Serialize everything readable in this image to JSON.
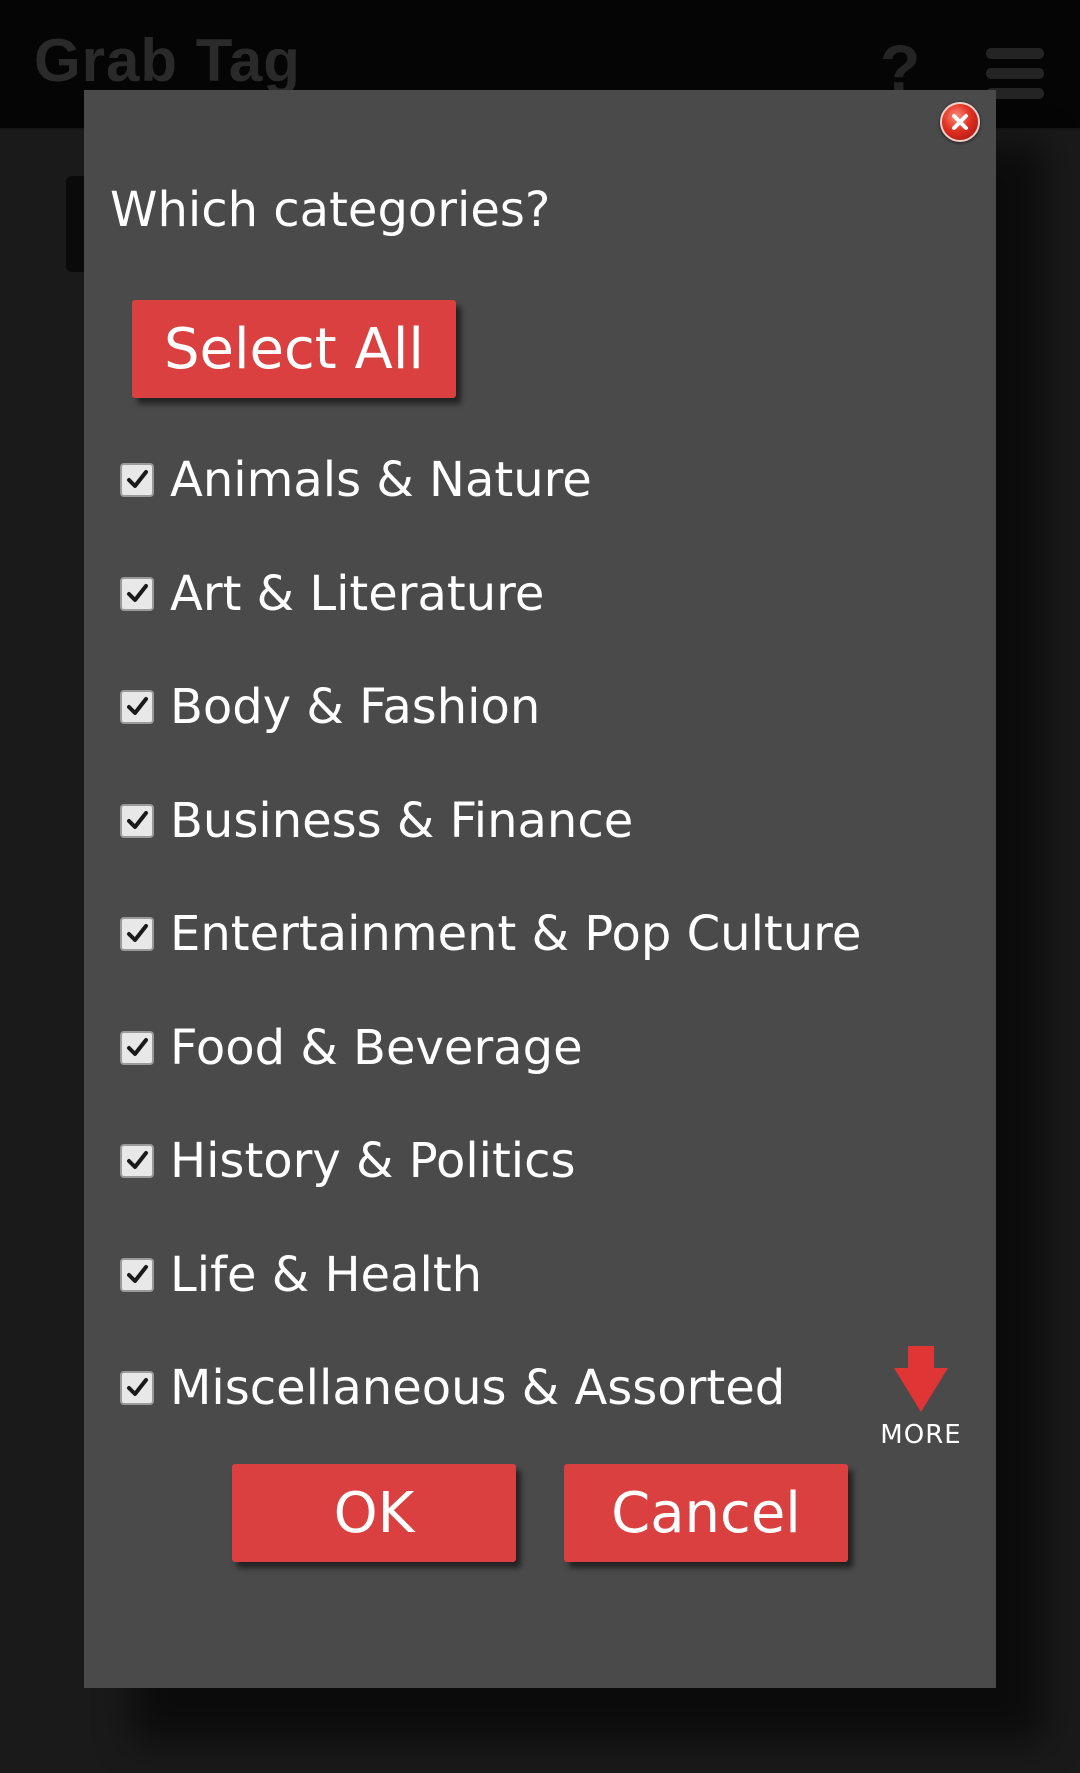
{
  "app": {
    "title": "Grab Tag",
    "help_glyph": "?"
  },
  "dialog": {
    "title": "Which categories?",
    "select_all_label": "Select All",
    "categories": [
      {
        "label": "Animals & Nature",
        "checked": true
      },
      {
        "label": "Art & Literature",
        "checked": true
      },
      {
        "label": "Body & Fashion",
        "checked": true
      },
      {
        "label": "Business & Finance",
        "checked": true
      },
      {
        "label": "Entertainment & Pop Culture",
        "checked": true
      },
      {
        "label": "Food & Beverage",
        "checked": true
      },
      {
        "label": "History & Politics",
        "checked": true
      },
      {
        "label": "Life & Health",
        "checked": true
      },
      {
        "label": "Miscellaneous & Assorted",
        "checked": true
      }
    ],
    "more_label": "MORE",
    "ok_label": "OK",
    "cancel_label": "Cancel"
  },
  "colors": {
    "button_red": "#da4040",
    "dialog_bg": "#4a4a4a",
    "header_bg": "#050505"
  },
  "icons": {
    "close": "close-icon",
    "menu": "hamburger-menu-icon",
    "help": "help-icon",
    "more": "arrow-down-icon",
    "checkbox": "checkbox-checked-icon"
  }
}
